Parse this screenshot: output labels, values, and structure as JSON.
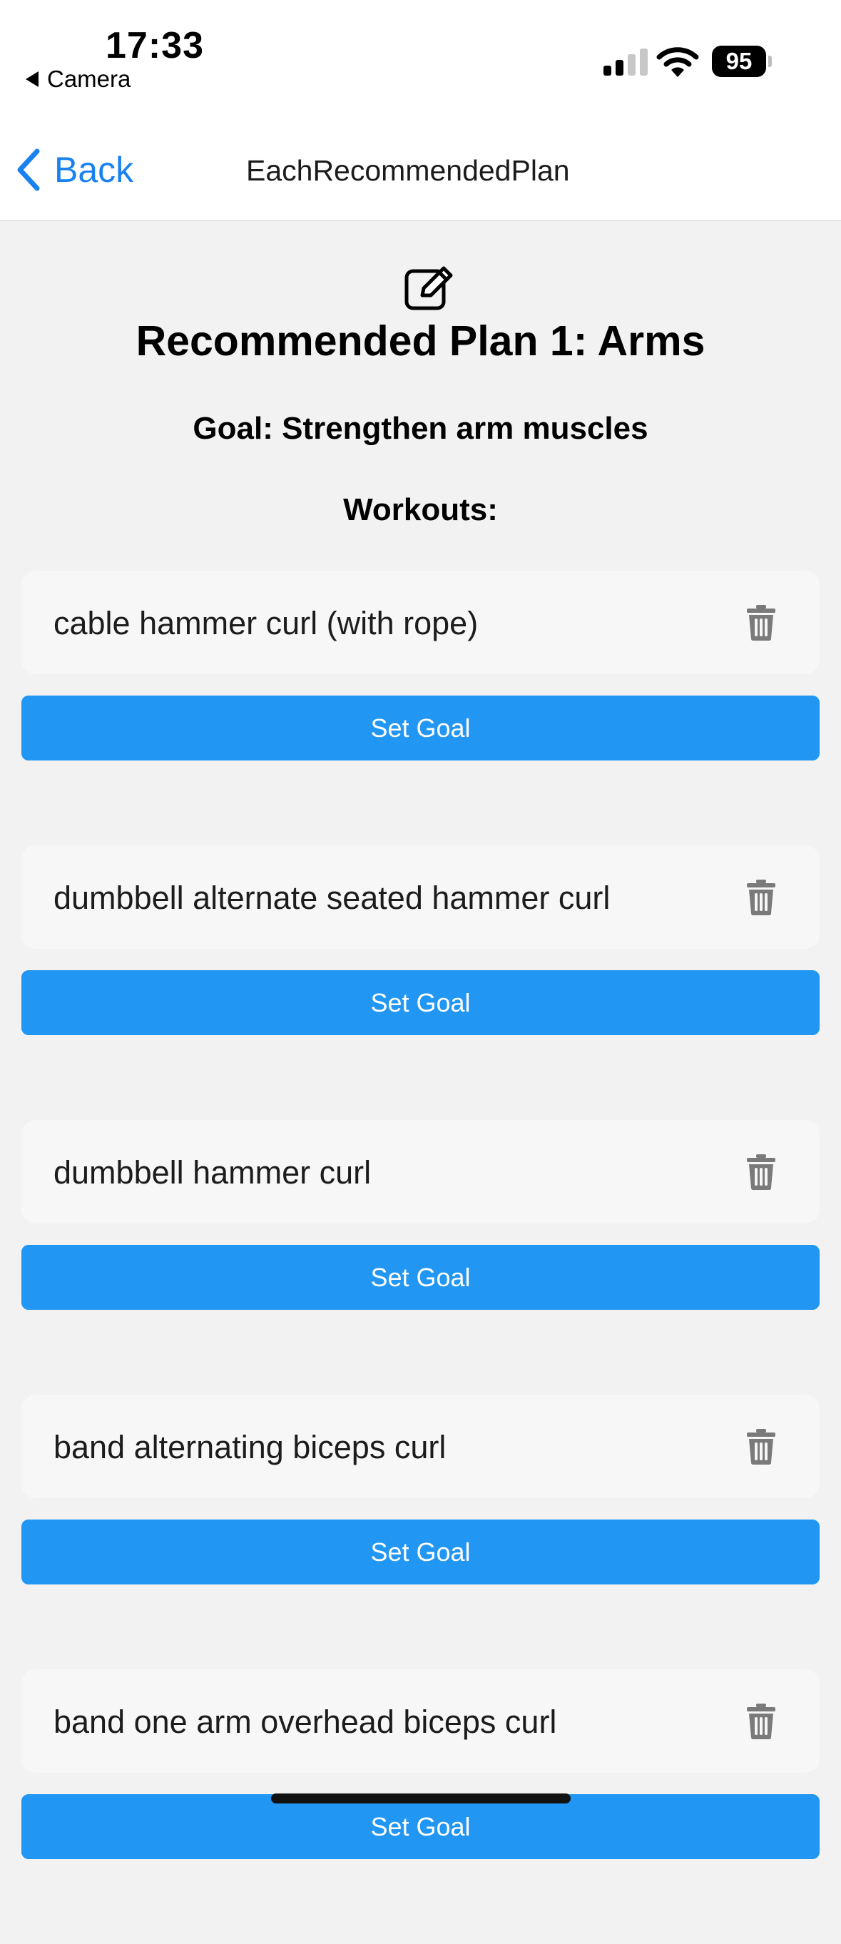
{
  "status_bar": {
    "time": "17:33",
    "back_app": "Camera",
    "battery": "95"
  },
  "nav": {
    "back_label": "Back",
    "title": "EachRecommendedPlan"
  },
  "plan": {
    "title": "Recommended Plan 1: Arms",
    "goal": "Goal: Strengthen arm muscles",
    "workouts_label": "Workouts:"
  },
  "workouts": [
    {
      "name": "cable hammer curl (with rope)",
      "button": "Set Goal"
    },
    {
      "name": "dumbbell alternate seated hammer curl",
      "button": "Set Goal"
    },
    {
      "name": "dumbbell hammer curl",
      "button": "Set Goal"
    },
    {
      "name": "band alternating biceps curl",
      "button": "Set Goal"
    },
    {
      "name": "band one arm overhead biceps curl",
      "button": "Set Goal"
    }
  ],
  "colors": {
    "accent": "#2196f3",
    "nav_link": "#1a82f0",
    "background": "#f2f2f2",
    "card": "#f7f7f7",
    "trash_icon": "#7a7a7a"
  },
  "icons": {
    "edit": "edit-icon",
    "delete": "trash-icon",
    "back": "chevron-left-icon"
  }
}
